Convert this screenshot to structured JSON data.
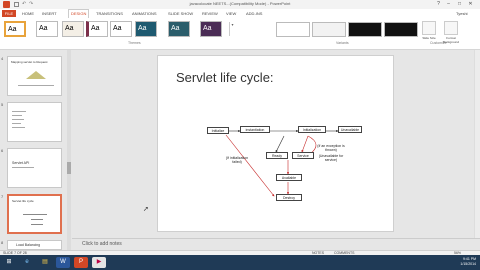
{
  "window": {
    "title": "javacolocate NEETS...(Compatibility Mode) - PowerPoint",
    "controls": [
      "?",
      "–",
      "□",
      "✕"
    ]
  },
  "ribbon": {
    "file_tab": "FILE",
    "tabs": [
      "HOME",
      "INSERT",
      "DESIGN",
      "TRANSITIONS",
      "ANIMATIONS",
      "SLIDE SHOW",
      "REVIEW",
      "VIEW",
      "ADD-INS"
    ],
    "active_tab": "DESIGN",
    "user": "Tyeshi",
    "themes_label": "Themes",
    "variants_label": "Variants",
    "customize_label": "Customize",
    "theme_glyph": "Aa",
    "customize_buttons": [
      "Slide Size",
      "Format Background"
    ],
    "colors": {
      "accent": "#d24726",
      "selected_border": "#e0704e"
    }
  },
  "thumbnails": [
    {
      "num": "4",
      "title": "Mapping servlet to Request"
    },
    {
      "num": "5",
      "title": ""
    },
    {
      "num": "6",
      "title": "Servlet API"
    },
    {
      "num": "7",
      "title": "Servlet life cycle"
    },
    {
      "num": "8",
      "title": "Load Balancing"
    }
  ],
  "slide": {
    "title": "Servlet life cycle:",
    "boxes": {
      "b1": "Initialize",
      "b2": "instantiation",
      "b3": "Initialization",
      "b4": "Ready",
      "b5": "Available",
      "b6": "Destroy",
      "b7": "Service",
      "b8": "Unavailable"
    },
    "labels": {
      "l1": "(If initialization failed)",
      "l2": "(If an exception is thrown)",
      "l3": "(Unavailable for service)"
    }
  },
  "notes_placeholder": "Click to add notes",
  "status": {
    "slide_info": "SLIDE 7 OF 28",
    "notes": "NOTES",
    "comments": "COMMENTS",
    "zoom": "56%"
  },
  "taskbar": {
    "icons": [
      "start-icon",
      "ie-icon",
      "explorer-icon",
      "word-icon",
      "powerpoint-icon",
      "video-icon"
    ],
    "glyphs": [
      "⊞",
      "e",
      "▤",
      "W",
      "P",
      "▶"
    ],
    "time": "9:41 PM",
    "date": "1/15/2014"
  }
}
